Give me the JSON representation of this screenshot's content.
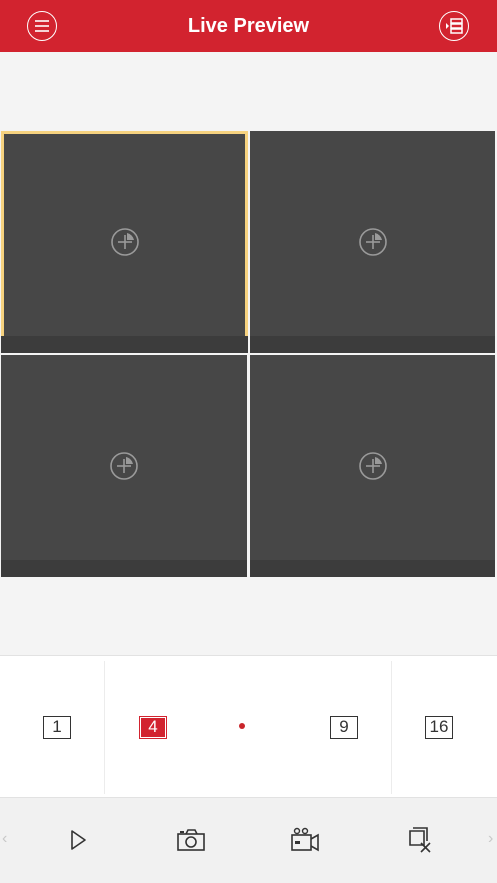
{
  "header": {
    "title": "Live Preview",
    "menu_icon": "menu-icon",
    "device_list_icon": "device-list-icon",
    "background_color": "#d2232f"
  },
  "preview_grid": {
    "cells": [
      {
        "label": "add-camera",
        "selected": true
      },
      {
        "label": "add-camera",
        "selected": false
      },
      {
        "label": "add-camera",
        "selected": false
      },
      {
        "label": "add-camera",
        "selected": false
      }
    ],
    "selected_border_color": "#f6d27f"
  },
  "layout_selector": {
    "options": [
      "1",
      "4",
      "9",
      "16"
    ],
    "active": "4"
  },
  "toolbar": {
    "items": [
      "play-icon",
      "camera-icon",
      "record-icon",
      "close-all-icon"
    ]
  }
}
